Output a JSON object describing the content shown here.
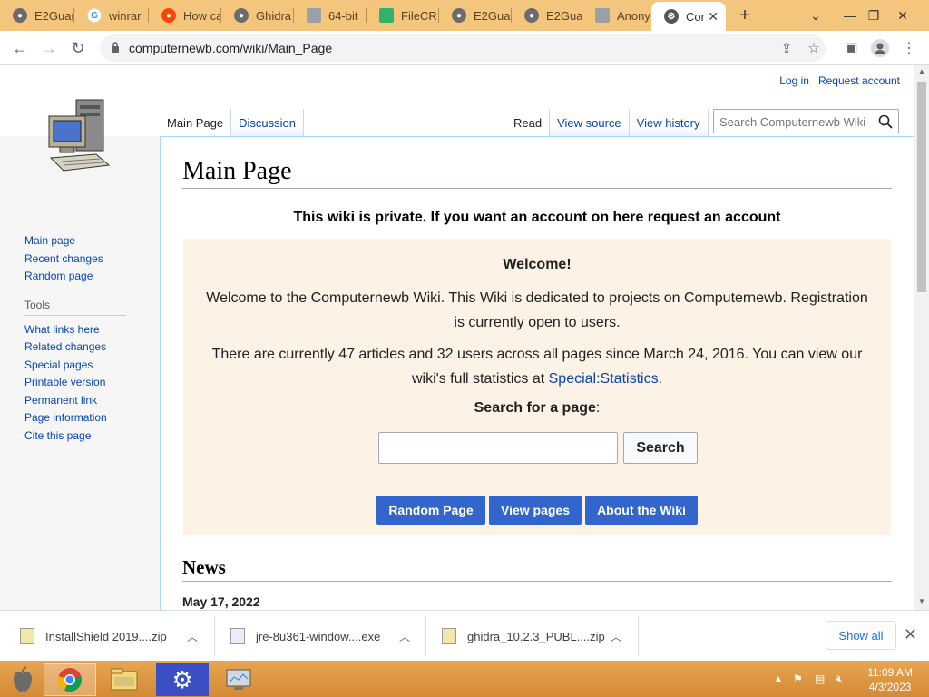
{
  "browser": {
    "tabs": [
      {
        "title": "E2Guar",
        "favicon": "globe"
      },
      {
        "title": "winrar",
        "favicon": "google"
      },
      {
        "title": "How ca",
        "favicon": "reddit"
      },
      {
        "title": "Ghidra",
        "favicon": "globe"
      },
      {
        "title": "64-bit",
        "favicon": "file"
      },
      {
        "title": "FileCR",
        "favicon": "filecr"
      },
      {
        "title": "E2Guar",
        "favicon": "globe"
      },
      {
        "title": "E2Guar",
        "favicon": "globe"
      },
      {
        "title": "Anony",
        "favicon": "file"
      },
      {
        "title": "Cor",
        "favicon": "wiki",
        "active": true
      }
    ],
    "url": "computernewb.com/wiki/Main_Page",
    "window_controls": [
      "chevron-down",
      "minimize",
      "restore",
      "close"
    ]
  },
  "wiki": {
    "personal": {
      "login": "Log in",
      "request": "Request account"
    },
    "page_tabs_left": [
      "Main Page",
      "Discussion"
    ],
    "page_tabs_right": [
      "Read",
      "View source",
      "View history"
    ],
    "search_placeholder": "Search Computernewb Wiki",
    "sidebar": {
      "nav": [
        "Main page",
        "Recent changes",
        "Random page"
      ],
      "tools_heading": "Tools",
      "tools": [
        "What links here",
        "Related changes",
        "Special pages",
        "Printable version",
        "Permanent link",
        "Page information",
        "Cite this page"
      ]
    },
    "heading": "Main Page",
    "notice": "This wiki is private. If you want an account on here request an account",
    "welcome": {
      "title": "Welcome!",
      "para1": "Welcome to the Computernewb Wiki. This Wiki is dedicated to projects on Computernewb. Registration is currently open to users.",
      "para2_prefix": "There are currently 47 articles and 32 users across all pages since March 24, 2016. You can view our wiki's full statistics at ",
      "para2_link": "Special:Statistics",
      "para2_suffix": ".",
      "search_label": "Search for a page",
      "search_label_colon": ":",
      "search_button": "Search",
      "buttons": [
        "Random Page",
        "View pages",
        "About the Wiki"
      ]
    },
    "news_heading": "News",
    "news_date": "May 17, 2022"
  },
  "downloads": {
    "items": [
      "InstallShield 2019....zip",
      "jre-8u361-window....exe",
      "ghidra_10.2.3_PUBL....zip"
    ],
    "show_all": "Show all"
  },
  "taskbar": {
    "time": "11:09 AM",
    "date": "4/3/2023"
  },
  "colors": {
    "tabstrip": "#f3c57d",
    "link": "#0645ad",
    "welcome_bg": "#fcf2e6",
    "button_blue": "#3366cc",
    "taskbar": "#d48a35"
  }
}
